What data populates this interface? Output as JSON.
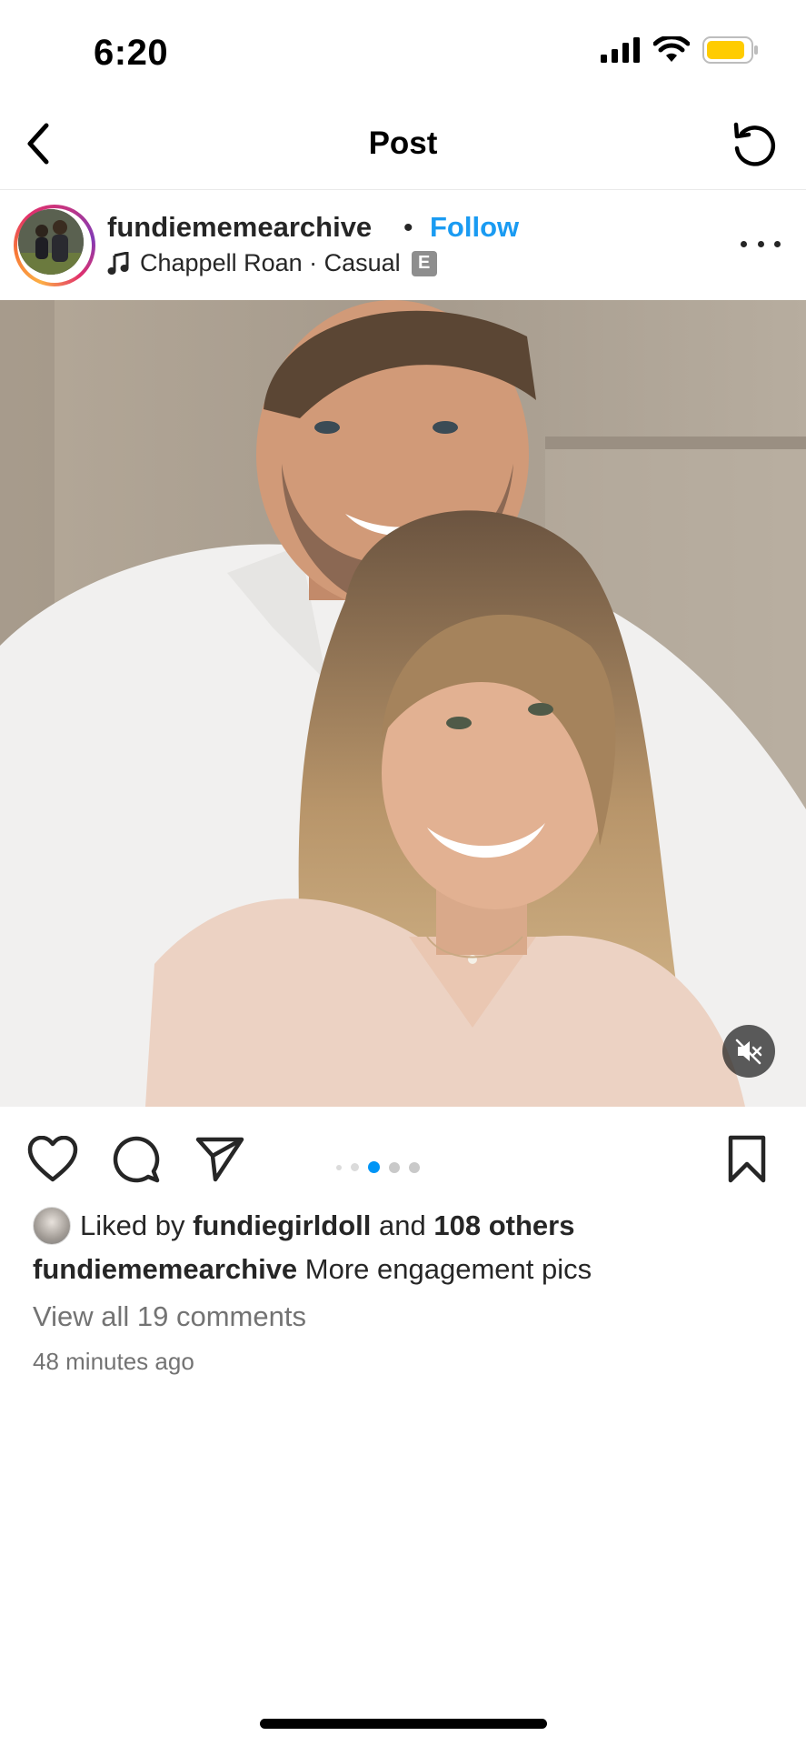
{
  "status_bar": {
    "time": "6:20",
    "battery_color": "#ffcc00"
  },
  "nav": {
    "title": "Post",
    "back_icon": "chevron-left",
    "refresh_icon": "refresh"
  },
  "post": {
    "username": "fundiememearchive",
    "separator": "•",
    "follow_label": "Follow",
    "music_artist_track": "Chappell Roan · Casual",
    "explicit_badge": "E",
    "media_slide_count": 5,
    "media_active_slide": 3
  },
  "engagement": {
    "liked_by_prefix": "Liked by",
    "liked_by_user": "fundiegirldoll",
    "and_text": "and",
    "others_text": "108 others",
    "caption_user": "fundiememearchive",
    "caption_text": "More engagement pics",
    "view_comments": "View all 19 comments",
    "timestamp": "48 minutes ago"
  },
  "colors": {
    "accent": "#1a9bf2",
    "secondary_text": "#737373",
    "active_dot": "#0095f6"
  }
}
